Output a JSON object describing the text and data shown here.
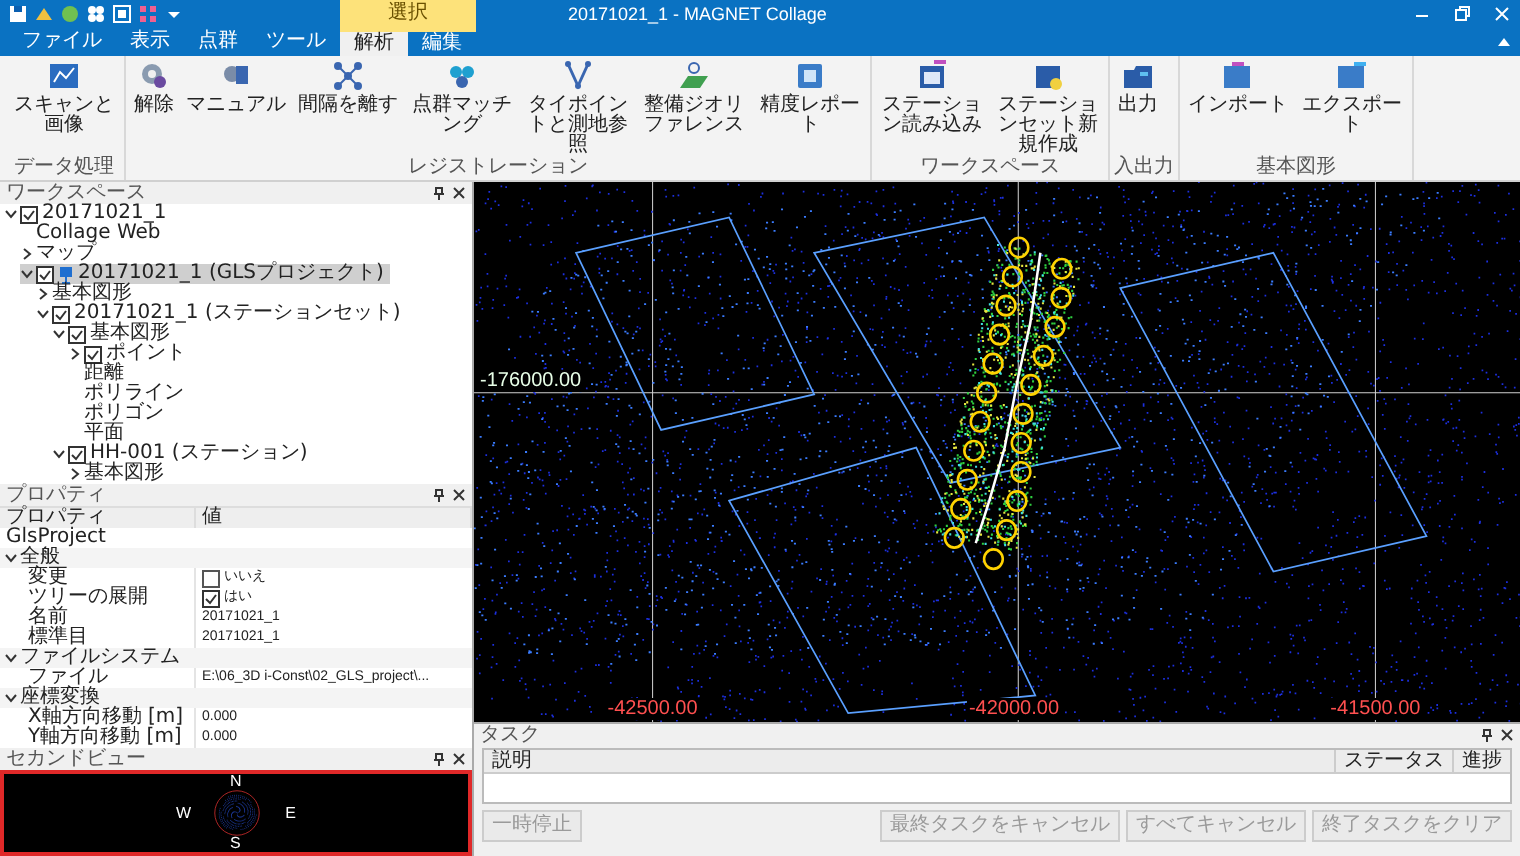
{
  "window": {
    "title": "20171021_1 - MAGNET Collage"
  },
  "tabs": [
    {
      "label": "ファイル",
      "selected": false
    },
    {
      "label": "表示",
      "selected": false
    },
    {
      "label": "点群",
      "selected": false
    },
    {
      "label": "ツール",
      "selected": false
    }
  ],
  "context_tabs": {
    "label": "選択",
    "tabs": [
      {
        "label": "解析",
        "selected": true
      },
      {
        "label": "編集",
        "selected": false
      }
    ]
  },
  "ribbon_groups": [
    {
      "label": "データ処理",
      "buttons": [
        "スキャンと画像"
      ]
    },
    {
      "label": "レジストレーション",
      "buttons": [
        "解除",
        "マニュアル",
        "間隔を離す",
        "点群マッチング",
        "タイポイントと測地参照",
        "整備ジオリファレンス",
        "精度レポート"
      ]
    },
    {
      "label": "ワークスペース",
      "buttons": [
        "ステーション読み込み",
        "ステーションセット新規作成"
      ]
    },
    {
      "label": "入出力",
      "buttons": [
        "出力"
      ]
    },
    {
      "label": "基本図形",
      "buttons": [
        "インポート",
        "エクスポート"
      ]
    }
  ],
  "workspace": {
    "title": "ワークスペース",
    "tree": [
      {
        "label": "20171021_1",
        "kind": "branch",
        "expanded": true,
        "checked": true,
        "selected": false,
        "children": [
          {
            "label": "Collage Web",
            "kind": "leaf",
            "selected": false
          },
          {
            "label": "マップ",
            "kind": "branch",
            "expanded": false,
            "selected": false
          },
          {
            "label": "20171021_1 (GLSプロジェクト)",
            "kind": "project",
            "expanded": true,
            "checked": true,
            "selected": true,
            "children": [
              {
                "label": "基本図形",
                "kind": "branch",
                "expanded": false,
                "selected": false
              },
              {
                "label": "20171021_1 (ステーションセット)",
                "kind": "branch",
                "expanded": true,
                "checked": true,
                "selected": false,
                "children": [
                  {
                    "label": "基本図形",
                    "kind": "branch",
                    "expanded": true,
                    "checked": true,
                    "selected": false,
                    "children": [
                      {
                        "label": "ポイント",
                        "kind": "branch",
                        "expanded": false,
                        "checked": true,
                        "selected": false
                      },
                      {
                        "label": "距離",
                        "kind": "leaf",
                        "selected": false
                      },
                      {
                        "label": "ポリライン",
                        "kind": "leaf",
                        "selected": false
                      },
                      {
                        "label": "ポリゴン",
                        "kind": "leaf",
                        "selected": false
                      },
                      {
                        "label": "平面",
                        "kind": "leaf",
                        "selected": false
                      }
                    ]
                  },
                  {
                    "label": "HH-001 (ステーション)",
                    "kind": "branch",
                    "expanded": true,
                    "checked": true,
                    "selected": false,
                    "children": [
                      {
                        "label": "基本図形",
                        "kind": "branch",
                        "expanded": false,
                        "selected": false
                      }
                    ]
                  }
                ]
              }
            ]
          }
        ]
      }
    ]
  },
  "properties": {
    "title": "プロパティ",
    "columns": [
      "プロパティ",
      "値"
    ],
    "object": "GlsProject",
    "rows": [
      {
        "kind": "category",
        "label": "全般",
        "expanded": true
      },
      {
        "kind": "check",
        "label": "変更",
        "checked": false,
        "value": "いいえ"
      },
      {
        "kind": "check",
        "label": "ツリーの展開",
        "checked": true,
        "value": "はい"
      },
      {
        "kind": "field",
        "label": "名前",
        "value": "20171021_1"
      },
      {
        "kind": "field",
        "label": "標準目",
        "value": "20171021_1"
      },
      {
        "kind": "category",
        "label": "ファイルシステム",
        "expanded": true
      },
      {
        "kind": "field",
        "label": "ファイル",
        "value": "E:\\06_3D i-Const\\02_GLS_project\\..."
      },
      {
        "kind": "category",
        "label": "座標変換",
        "expanded": true
      },
      {
        "kind": "field",
        "label": "X軸方向移動 [m]",
        "value": "0.000"
      },
      {
        "kind": "field",
        "label": "Y軸方向移動 [m]",
        "value": "0.000"
      }
    ]
  },
  "overview": {
    "title": "セカンドビュー",
    "compass": [
      "N",
      "E",
      "S",
      "W"
    ]
  },
  "view": {
    "y_labels": [
      "-176000.00"
    ],
    "x_labels": [
      "-42500.00",
      "-42000.00",
      "-41500.00"
    ]
  },
  "tasks": {
    "title": "タスク",
    "columns": [
      "説明",
      "ステータス",
      "進捗"
    ],
    "buttons": [
      {
        "label": "一時停止",
        "disabled": true
      },
      {
        "label": "最終タスクをキャンセル",
        "disabled": true
      },
      {
        "label": "すべてキャンセル",
        "disabled": true
      },
      {
        "label": "終了タスクをクリア",
        "disabled": true
      }
    ]
  }
}
